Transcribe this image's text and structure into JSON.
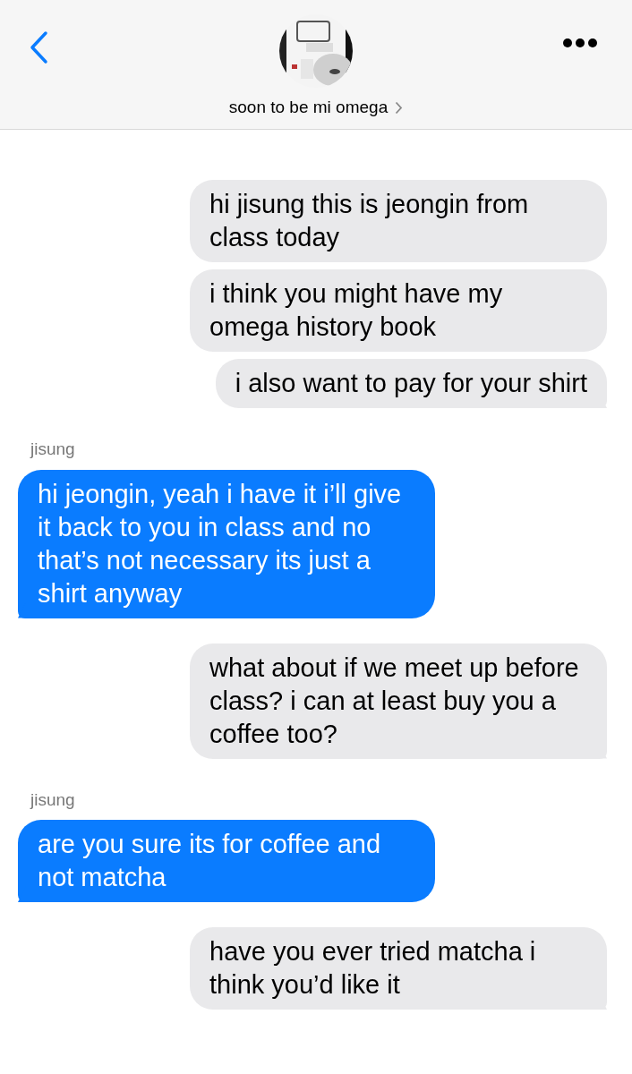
{
  "header": {
    "contact_name": "soon to be mi omega"
  },
  "messages": [
    {
      "kind": "sent",
      "text": "hi jisung this is jeongin from class today",
      "tail": false
    },
    {
      "kind": "sent",
      "text": "i think you might have my omega history book",
      "tail": false
    },
    {
      "kind": "sent",
      "text": "i also want to pay for your shirt",
      "tail": true
    },
    {
      "kind": "received",
      "sender": "jisung",
      "text": "hi jeongin, yeah i have it i’ll give it back to you in class and no that’s not necessary its just a shirt anyway",
      "tail": true
    },
    {
      "kind": "sent",
      "text": "what about if we meet up before class? i can at least buy you a coffee too?",
      "tail": true
    },
    {
      "kind": "received",
      "sender": "jisung",
      "text": "are you sure its for coffee and not matcha",
      "tail": true
    },
    {
      "kind": "sent",
      "text": "have you ever tried matcha i think you’d like it",
      "tail": true
    }
  ]
}
